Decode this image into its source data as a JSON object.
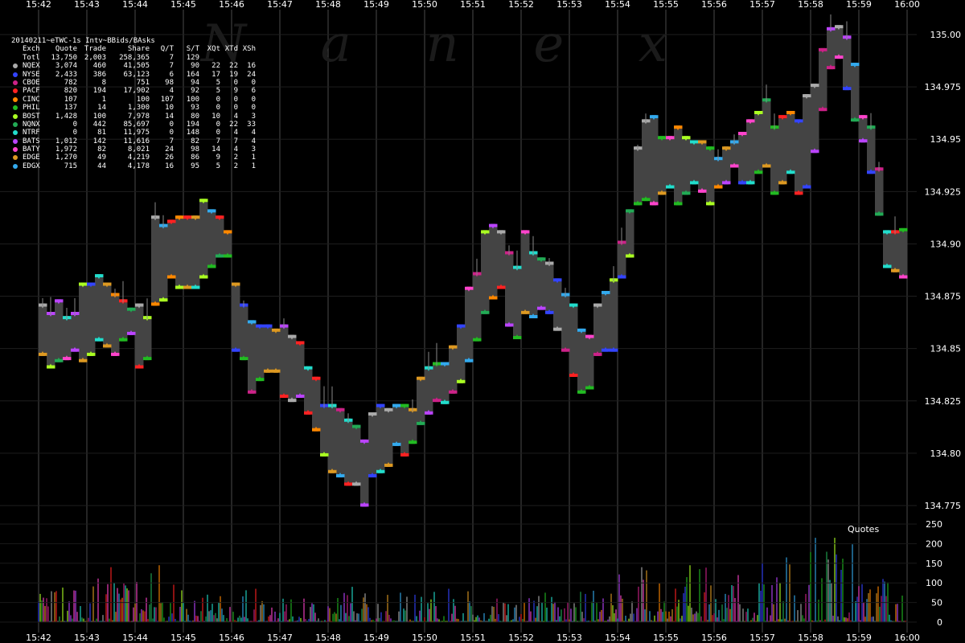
{
  "header": {
    "title": "20140211~eTWC-1s Intv~BBids/BAsks",
    "columns": [
      "Exch",
      "Quote",
      "Trade",
      "Share",
      "Q/T",
      "S/T",
      "XQt",
      "XTd",
      "XSh"
    ]
  },
  "legend": [
    {
      "exch": "Totl",
      "quote": "13,750",
      "trade": "2,003",
      "share": "258,365",
      "qt": "7",
      "st": "129",
      "xqt": "",
      "xtd": "",
      "xsh": "",
      "color": ""
    },
    {
      "exch": "NQEX",
      "quote": "3,074",
      "trade": "460",
      "share": "41,505",
      "qt": "7",
      "st": "90",
      "xqt": "22",
      "xtd": "22",
      "xsh": "16",
      "color": "#aaaaaa"
    },
    {
      "exch": "NYSE",
      "quote": "2,433",
      "trade": "386",
      "share": "63,123",
      "qt": "6",
      "st": "164",
      "xqt": "17",
      "xtd": "19",
      "xsh": "24",
      "color": "#3344ff"
    },
    {
      "exch": "CBOE",
      "quote": "782",
      "trade": "8",
      "share": "751",
      "qt": "98",
      "st": "94",
      "xqt": "5",
      "xtd": "0",
      "xsh": "0",
      "color": "#cc2288"
    },
    {
      "exch": "PACF",
      "quote": "820",
      "trade": "194",
      "share": "17,902",
      "qt": "4",
      "st": "92",
      "xqt": "5",
      "xtd": "9",
      "xsh": "6",
      "color": "#ff2222"
    },
    {
      "exch": "CINC",
      "quote": "107",
      "trade": "1",
      "share": "100",
      "qt": "107",
      "st": "100",
      "xqt": "0",
      "xtd": "0",
      "xsh": "0",
      "color": "#ff8800"
    },
    {
      "exch": "PHIL",
      "quote": "137",
      "trade": "14",
      "share": "1,300",
      "qt": "10",
      "st": "93",
      "xqt": "0",
      "xtd": "0",
      "xsh": "0",
      "color": "#22bb22"
    },
    {
      "exch": "BOST",
      "quote": "1,428",
      "trade": "100",
      "share": "7,978",
      "qt": "14",
      "st": "80",
      "xqt": "10",
      "xtd": "4",
      "xsh": "3",
      "color": "#aaff22"
    },
    {
      "exch": "NQNX",
      "quote": "0",
      "trade": "442",
      "share": "85,697",
      "qt": "0",
      "st": "194",
      "xqt": "0",
      "xtd": "22",
      "xsh": "33",
      "color": "#22aa55"
    },
    {
      "exch": "NTRF",
      "quote": "0",
      "trade": "81",
      "share": "11,975",
      "qt": "0",
      "st": "148",
      "xqt": "0",
      "xtd": "4",
      "xsh": "4",
      "color": "#22ddcc"
    },
    {
      "exch": "BATS",
      "quote": "1,012",
      "trade": "142",
      "share": "11,616",
      "qt": "7",
      "st": "82",
      "xqt": "7",
      "xtd": "7",
      "xsh": "4",
      "color": "#bb44ff"
    },
    {
      "exch": "BATY",
      "quote": "1,972",
      "trade": "82",
      "share": "8,021",
      "qt": "24",
      "st": "98",
      "xqt": "14",
      "xtd": "4",
      "xsh": "3",
      "color": "#ff44cc"
    },
    {
      "exch": "EDGE",
      "quote": "1,270",
      "trade": "49",
      "share": "4,219",
      "qt": "26",
      "st": "86",
      "xqt": "9",
      "xtd": "2",
      "xsh": "1",
      "color": "#dd9922"
    },
    {
      "exch": "EDGX",
      "quote": "715",
      "trade": "44",
      "share": "4,178",
      "qt": "16",
      "st": "95",
      "xqt": "5",
      "xtd": "2",
      "xsh": "1",
      "color": "#33aaee"
    }
  ],
  "brand": [
    "N",
    "a",
    "n",
    "e",
    "x"
  ],
  "quotes_label": "Quotes",
  "chart_data": {
    "type": "bar",
    "x_ticks": [
      "15:42",
      "15:43",
      "15:44",
      "15:45",
      "15:46",
      "15:47",
      "15:48",
      "15:49",
      "15:50",
      "15:51",
      "15:52",
      "15:53",
      "15:54",
      "15:55",
      "15:56",
      "15:57",
      "15:58",
      "15:59",
      "16:00"
    ],
    "price_ticks": [
      134.775,
      134.8,
      134.825,
      134.85,
      134.875,
      134.9,
      134.925,
      134.95,
      134.975,
      135.0
    ],
    "price_tick_labels": [
      "134.775",
      "134.80",
      "134.825",
      "134.85",
      "134.875",
      "134.90",
      "134.925",
      "134.95",
      "134.975",
      "135.00"
    ],
    "ylim": [
      134.765,
      135.01
    ],
    "quote_ticks": [
      0,
      50,
      100,
      150,
      200,
      250
    ],
    "quote_ylim": [
      0,
      250
    ],
    "spread_series": [
      {
        "t": "15:42:00",
        "bid": 134.848,
        "ask": 134.87
      },
      {
        "t": "15:42:10",
        "bid": 134.842,
        "ask": 134.866
      },
      {
        "t": "15:42:20",
        "bid": 134.845,
        "ask": 134.872
      },
      {
        "t": "15:42:30",
        "bid": 134.846,
        "ask": 134.864
      },
      {
        "t": "15:42:40",
        "bid": 134.85,
        "ask": 134.866
      },
      {
        "t": "15:42:50",
        "bid": 134.845,
        "ask": 134.88
      },
      {
        "t": "15:43:00",
        "bid": 134.848,
        "ask": 134.88
      },
      {
        "t": "15:43:10",
        "bid": 134.855,
        "ask": 134.884
      },
      {
        "t": "15:43:20",
        "bid": 134.852,
        "ask": 134.88
      },
      {
        "t": "15:43:30",
        "bid": 134.848,
        "ask": 134.875
      },
      {
        "t": "15:43:40",
        "bid": 134.855,
        "ask": 134.872
      },
      {
        "t": "15:43:50",
        "bid": 134.858,
        "ask": 134.868
      },
      {
        "t": "15:44:00",
        "bid": 134.842,
        "ask": 134.87
      },
      {
        "t": "15:44:10",
        "bid": 134.846,
        "ask": 134.864
      },
      {
        "t": "15:44:20",
        "bid": 134.872,
        "ask": 134.912
      },
      {
        "t": "15:44:30",
        "bid": 134.874,
        "ask": 134.908
      },
      {
        "t": "15:44:40",
        "bid": 134.885,
        "ask": 134.91
      },
      {
        "t": "15:44:50",
        "bid": 134.88,
        "ask": 134.912
      },
      {
        "t": "15:45:00",
        "bid": 134.88,
        "ask": 134.912
      },
      {
        "t": "15:45:10",
        "bid": 134.88,
        "ask": 134.912
      },
      {
        "t": "15:45:20",
        "bid": 134.885,
        "ask": 134.92
      },
      {
        "t": "15:45:30",
        "bid": 134.89,
        "ask": 134.915
      },
      {
        "t": "15:45:40",
        "bid": 134.895,
        "ask": 134.912
      },
      {
        "t": "15:45:50",
        "bid": 134.895,
        "ask": 134.905
      },
      {
        "t": "15:46:00",
        "bid": 134.85,
        "ask": 134.88
      },
      {
        "t": "15:46:10",
        "bid": 134.846,
        "ask": 134.87
      },
      {
        "t": "15:46:20",
        "bid": 134.83,
        "ask": 134.862
      },
      {
        "t": "15:46:30",
        "bid": 134.836,
        "ask": 134.86
      },
      {
        "t": "15:46:40",
        "bid": 134.84,
        "ask": 134.86
      },
      {
        "t": "15:46:50",
        "bid": 134.84,
        "ask": 134.858
      },
      {
        "t": "15:47:00",
        "bid": 134.828,
        "ask": 134.86
      },
      {
        "t": "15:47:10",
        "bid": 134.826,
        "ask": 134.855
      },
      {
        "t": "15:47:20",
        "bid": 134.828,
        "ask": 134.852
      },
      {
        "t": "15:47:30",
        "bid": 134.82,
        "ask": 134.84
      },
      {
        "t": "15:47:40",
        "bid": 134.812,
        "ask": 134.835
      },
      {
        "t": "15:47:50",
        "bid": 134.8,
        "ask": 134.822
      },
      {
        "t": "15:48:00",
        "bid": 134.792,
        "ask": 134.822
      },
      {
        "t": "15:48:10",
        "bid": 134.79,
        "ask": 134.82
      },
      {
        "t": "15:48:20",
        "bid": 134.786,
        "ask": 134.815
      },
      {
        "t": "15:48:30",
        "bid": 134.786,
        "ask": 134.812
      },
      {
        "t": "15:48:40",
        "bid": 134.776,
        "ask": 134.805
      },
      {
        "t": "15:48:50",
        "bid": 134.79,
        "ask": 134.818
      },
      {
        "t": "15:49:00",
        "bid": 134.792,
        "ask": 134.822
      },
      {
        "t": "15:49:10",
        "bid": 134.795,
        "ask": 134.82
      },
      {
        "t": "15:49:20",
        "bid": 134.805,
        "ask": 134.822
      },
      {
        "t": "15:49:30",
        "bid": 134.8,
        "ask": 134.822
      },
      {
        "t": "15:49:40",
        "bid": 134.806,
        "ask": 134.82
      },
      {
        "t": "15:49:50",
        "bid": 134.815,
        "ask": 134.835
      },
      {
        "t": "15:50:00",
        "bid": 134.82,
        "ask": 134.84
      },
      {
        "t": "15:50:10",
        "bid": 134.826,
        "ask": 134.842
      },
      {
        "t": "15:50:20",
        "bid": 134.825,
        "ask": 134.842
      },
      {
        "t": "15:50:30",
        "bid": 134.83,
        "ask": 134.85
      },
      {
        "t": "15:50:40",
        "bid": 134.835,
        "ask": 134.86
      },
      {
        "t": "15:50:50",
        "bid": 134.845,
        "ask": 134.878
      },
      {
        "t": "15:51:00",
        "bid": 134.855,
        "ask": 134.885
      },
      {
        "t": "15:51:10",
        "bid": 134.868,
        "ask": 134.905
      },
      {
        "t": "15:51:20",
        "bid": 134.875,
        "ask": 134.908
      },
      {
        "t": "15:51:30",
        "bid": 134.88,
        "ask": 134.905
      },
      {
        "t": "15:51:40",
        "bid": 134.862,
        "ask": 134.895
      },
      {
        "t": "15:51:50",
        "bid": 134.856,
        "ask": 134.888
      },
      {
        "t": "15:52:00",
        "bid": 134.868,
        "ask": 134.905
      },
      {
        "t": "15:52:10",
        "bid": 134.866,
        "ask": 134.895
      },
      {
        "t": "15:52:20",
        "bid": 134.87,
        "ask": 134.892
      },
      {
        "t": "15:52:30",
        "bid": 134.868,
        "ask": 134.89
      },
      {
        "t": "15:52:40",
        "bid": 134.86,
        "ask": 134.882
      },
      {
        "t": "15:52:50",
        "bid": 134.85,
        "ask": 134.875
      },
      {
        "t": "15:53:00",
        "bid": 134.838,
        "ask": 134.87
      },
      {
        "t": "15:53:10",
        "bid": 134.83,
        "ask": 134.858
      },
      {
        "t": "15:53:20",
        "bid": 134.832,
        "ask": 134.855
      },
      {
        "t": "15:53:30",
        "bid": 134.848,
        "ask": 134.87
      },
      {
        "t": "15:53:40",
        "bid": 134.85,
        "ask": 134.876
      },
      {
        "t": "15:53:50",
        "bid": 134.85,
        "ask": 134.882
      },
      {
        "t": "15:54:00",
        "bid": 134.885,
        "ask": 134.9
      },
      {
        "t": "15:54:10",
        "bid": 134.895,
        "ask": 134.915
      },
      {
        "t": "15:54:20",
        "bid": 134.92,
        "ask": 134.945
      },
      {
        "t": "15:54:30",
        "bid": 134.922,
        "ask": 134.958
      },
      {
        "t": "15:54:40",
        "bid": 134.92,
        "ask": 134.96
      },
      {
        "t": "15:54:50",
        "bid": 134.925,
        "ask": 134.95
      },
      {
        "t": "15:55:00",
        "bid": 134.928,
        "ask": 134.95
      },
      {
        "t": "15:55:10",
        "bid": 134.92,
        "ask": 134.955
      },
      {
        "t": "15:55:20",
        "bid": 134.925,
        "ask": 134.95
      },
      {
        "t": "15:55:30",
        "bid": 134.93,
        "ask": 134.948
      },
      {
        "t": "15:55:40",
        "bid": 134.926,
        "ask": 134.948
      },
      {
        "t": "15:55:50",
        "bid": 134.92,
        "ask": 134.945
      },
      {
        "t": "15:56:00",
        "bid": 134.928,
        "ask": 134.94
      },
      {
        "t": "15:56:10",
        "bid": 134.93,
        "ask": 134.945
      },
      {
        "t": "15:56:20",
        "bid": 134.938,
        "ask": 134.948
      },
      {
        "t": "15:56:30",
        "bid": 134.93,
        "ask": 134.952
      },
      {
        "t": "15:56:40",
        "bid": 134.93,
        "ask": 134.958
      },
      {
        "t": "15:56:50",
        "bid": 134.935,
        "ask": 134.962
      },
      {
        "t": "15:57:00",
        "bid": 134.938,
        "ask": 134.968
      },
      {
        "t": "15:57:10",
        "bid": 134.925,
        "ask": 134.955
      },
      {
        "t": "15:57:20",
        "bid": 134.93,
        "ask": 134.96
      },
      {
        "t": "15:57:30",
        "bid": 134.935,
        "ask": 134.962
      },
      {
        "t": "15:57:40",
        "bid": 134.925,
        "ask": 134.958
      },
      {
        "t": "15:57:50",
        "bid": 134.928,
        "ask": 134.97
      },
      {
        "t": "15:58:00",
        "bid": 134.945,
        "ask": 134.975
      },
      {
        "t": "15:58:10",
        "bid": 134.965,
        "ask": 134.992
      },
      {
        "t": "15:58:20",
        "bid": 134.985,
        "ask": 135.002
      },
      {
        "t": "15:58:30",
        "bid": 134.99,
        "ask": 135.003
      },
      {
        "t": "15:58:40",
        "bid": 134.975,
        "ask": 134.998
      },
      {
        "t": "15:58:50",
        "bid": 134.96,
        "ask": 134.985
      },
      {
        "t": "15:59:00",
        "bid": 134.95,
        "ask": 134.96
      },
      {
        "t": "15:59:10",
        "bid": 134.935,
        "ask": 134.955
      },
      {
        "t": "15:59:20",
        "bid": 134.915,
        "ask": 134.935
      },
      {
        "t": "15:59:30",
        "bid": 134.89,
        "ask": 134.905
      },
      {
        "t": "15:59:40",
        "bid": 134.888,
        "ask": 134.905
      },
      {
        "t": "15:59:50",
        "bid": 134.885,
        "ask": 134.906
      }
    ],
    "quotes_per_interval": [
      {
        "t": "15:42",
        "max": 88
      },
      {
        "t": "15:43",
        "max": 140
      },
      {
        "t": "15:44",
        "max": 145
      },
      {
        "t": "15:45",
        "max": 70
      },
      {
        "t": "15:46",
        "max": 85
      },
      {
        "t": "15:47",
        "max": 60
      },
      {
        "t": "15:48",
        "max": 90
      },
      {
        "t": "15:49",
        "max": 75
      },
      {
        "t": "15:50",
        "max": 85
      },
      {
        "t": "15:51",
        "max": 60
      },
      {
        "t": "15:52",
        "max": 75
      },
      {
        "t": "15:53",
        "max": 80
      },
      {
        "t": "15:54",
        "max": 140
      },
      {
        "t": "15:55",
        "max": 145
      },
      {
        "t": "15:56",
        "max": 120
      },
      {
        "t": "15:57",
        "max": 165
      },
      {
        "t": "15:58",
        "max": 215
      },
      {
        "t": "15:59",
        "max": 110
      }
    ]
  }
}
